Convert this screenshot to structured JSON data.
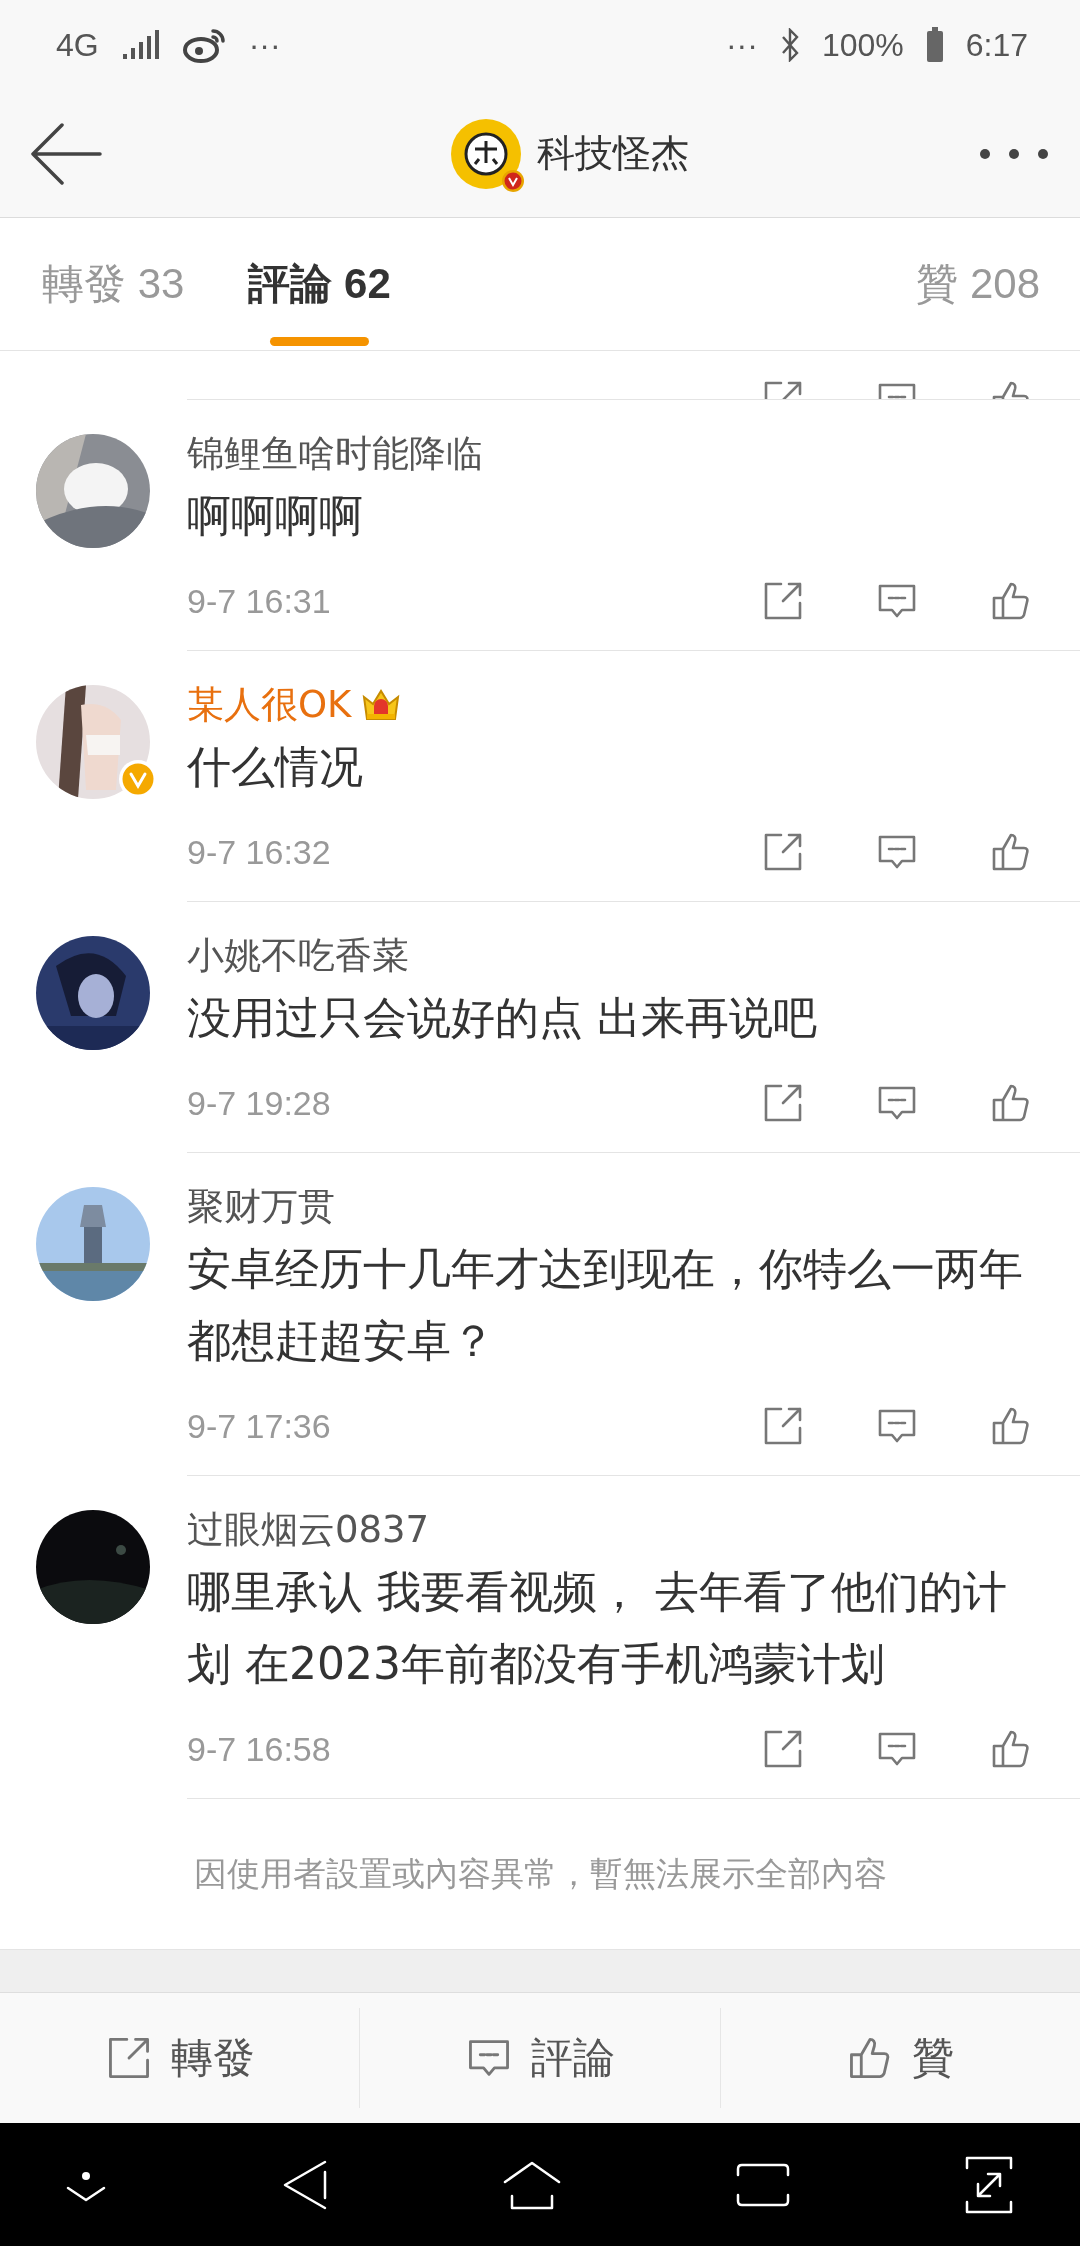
{
  "status_bar": {
    "network": "4G",
    "left_more": "···",
    "right_more": "···",
    "battery": "100%",
    "time": "6:17"
  },
  "header": {
    "title": "科技怪杰",
    "verified": true
  },
  "tabs": [
    {
      "label": "轉發 33",
      "selected": false
    },
    {
      "label": "評論 62",
      "selected": true
    },
    {
      "label": "贊 208",
      "selected": false
    }
  ],
  "comments": [
    {
      "name": "锦鲤鱼啥时能降临",
      "vip": false,
      "verified": false,
      "text": "啊啊啊啊",
      "time": "9-7 16:31"
    },
    {
      "name": "某人很OK",
      "vip": true,
      "verified": true,
      "text": "什么情况",
      "time": "9-7 16:32"
    },
    {
      "name": "小姚不吃香菜",
      "vip": false,
      "verified": false,
      "text": "没用过只会说好的点 出来再说吧",
      "time": "9-7 19:28"
    },
    {
      "name": "聚财万贯",
      "vip": false,
      "verified": false,
      "text": "安卓经历十几年才达到现在，你特么一两年都想赶超安卓？",
      "time": "9-7 17:36"
    },
    {
      "name": "过眼烟云0837",
      "vip": false,
      "verified": false,
      "text": "哪里承认 我要看视频， 去年看了他们的计划 在2023年前都没有手机鸿蒙计划",
      "time": "9-7 16:58"
    }
  ],
  "notice": "因使用者設置或內容異常，暫無法展示全部內容",
  "actions": [
    {
      "kind": "repost",
      "label": "轉發"
    },
    {
      "kind": "comment",
      "label": "評論"
    },
    {
      "kind": "like",
      "label": "贊"
    }
  ]
}
